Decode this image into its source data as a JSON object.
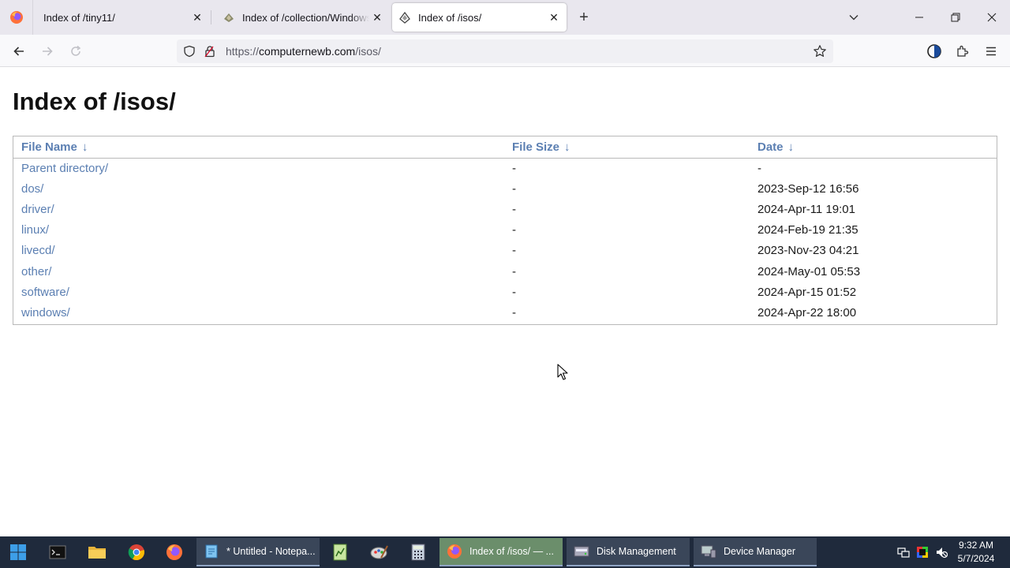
{
  "browser": {
    "tabs": [
      {
        "title": "Index of /tiny11/",
        "active": false
      },
      {
        "title": "Index of /collection/Windows XP",
        "active": false
      },
      {
        "title": "Index of /isos/",
        "active": true
      }
    ],
    "url": {
      "scheme": "https://",
      "host": "computernewb.com",
      "path": "/isos/"
    }
  },
  "page": {
    "title": "Index of /isos/",
    "columns": [
      {
        "label": "File Name",
        "sort": "↓"
      },
      {
        "label": "File Size",
        "sort": "↓"
      },
      {
        "label": "Date",
        "sort": "↓"
      }
    ],
    "rows": [
      {
        "name": "Parent directory/",
        "size": "-",
        "date": "-"
      },
      {
        "name": "dos/",
        "size": "-",
        "date": "2023-Sep-12 16:56"
      },
      {
        "name": "driver/",
        "size": "-",
        "date": "2024-Apr-11 19:01"
      },
      {
        "name": "linux/",
        "size": "-",
        "date": "2024-Feb-19 21:35"
      },
      {
        "name": "livecd/",
        "size": "-",
        "date": "2023-Nov-23 04:21"
      },
      {
        "name": "other/",
        "size": "-",
        "date": "2024-May-01 05:53"
      },
      {
        "name": "software/",
        "size": "-",
        "date": "2024-Apr-15 01:52"
      },
      {
        "name": "windows/",
        "size": "-",
        "date": "2024-Apr-22 18:00"
      }
    ]
  },
  "taskbar": {
    "apps": [
      {
        "label": "* Untitled - Notepa...",
        "icon": "notepad-icon"
      },
      {
        "label": "Index of /isos/ — ...",
        "icon": "firefox-icon"
      },
      {
        "label": "Disk Management",
        "icon": "disk-management-icon"
      },
      {
        "label": "Device Manager",
        "icon": "device-manager-icon"
      }
    ],
    "clock": {
      "time": "9:32 AM",
      "date": "5/7/2024"
    }
  },
  "colors": {
    "link": "#5b7fb2",
    "taskbar": "#1f2a3c",
    "tabstrip": "#e9e7ee"
  }
}
